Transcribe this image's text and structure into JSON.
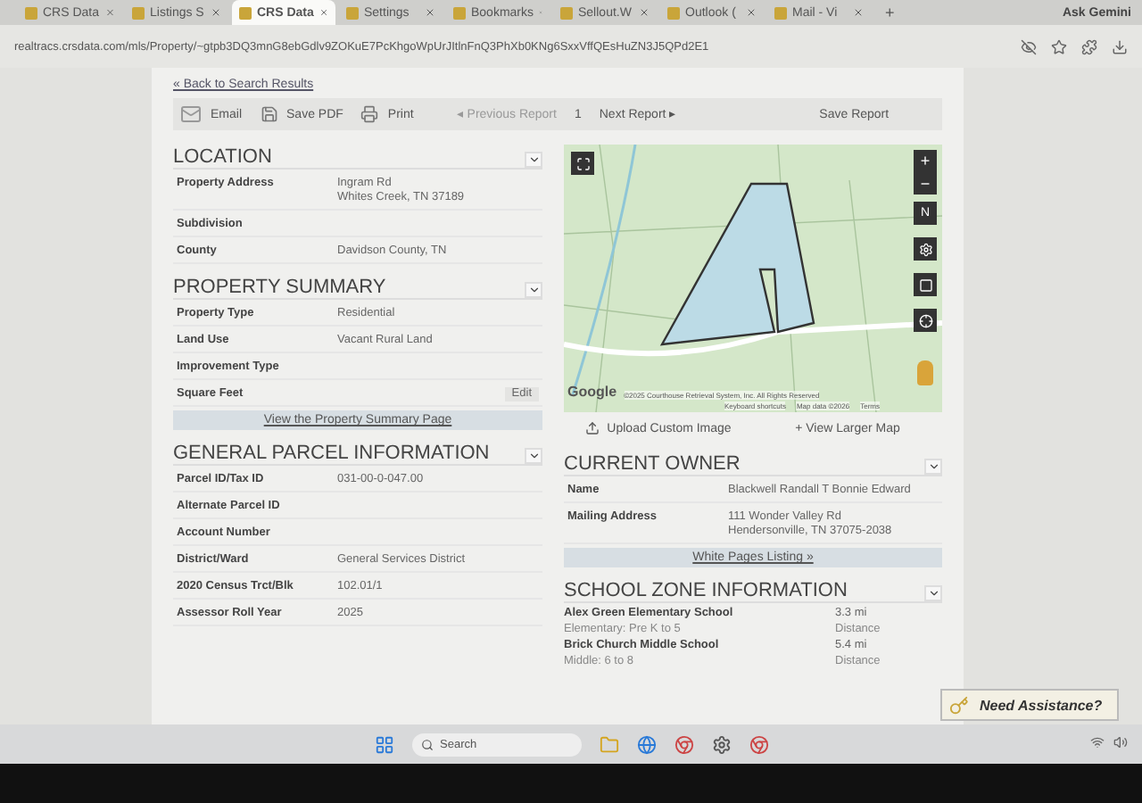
{
  "browser": {
    "tabs": [
      {
        "label": "CRS Data",
        "selected": false
      },
      {
        "label": "Listings S",
        "selected": false
      },
      {
        "label": "CRS Data",
        "selected": true
      },
      {
        "label": "Settings",
        "selected": false
      },
      {
        "label": "Bookmarks",
        "selected": false
      },
      {
        "label": "Sellout.W",
        "selected": false
      },
      {
        "label": "Outlook (",
        "selected": false
      },
      {
        "label": "Mail - Vi",
        "selected": false
      }
    ],
    "new_tab": "+",
    "gemini": "Ask Gemini",
    "url": "realtracs.crsdata.com/mls/Property/~gtpb3DQ3mnG8ebGdlv9ZOKuE7PcKhgoWpUrJItlnFnQ3PhXb0KNg6SxxVffQEsHuZN3J5QPd2E1"
  },
  "nav": {
    "back": "« Back to Search Results"
  },
  "toolbar": {
    "email": "Email",
    "save_pdf": "Save PDF",
    "print": "Print",
    "previous": "◂ Previous Report",
    "page": "1",
    "next": "Next Report ▸",
    "save": "Save Report"
  },
  "location": {
    "title": "LOCATION",
    "rows": [
      {
        "label": "Property Address",
        "value_lines": [
          "Ingram Rd",
          "Whites Creek, TN 37189"
        ]
      },
      {
        "label": "Subdivision",
        "value_lines": []
      },
      {
        "label": "County",
        "value_lines": [
          "Davidson County, TN"
        ]
      }
    ]
  },
  "summary": {
    "title": "PROPERTY SUMMARY",
    "rows": [
      {
        "label": "Property Type",
        "value_lines": [
          "Residential"
        ]
      },
      {
        "label": "Land Use",
        "value_lines": [
          "Vacant Rural Land"
        ]
      },
      {
        "label": "Improvement Type",
        "value_lines": []
      },
      {
        "label": "Square Feet",
        "value_lines": []
      }
    ],
    "edit": "Edit",
    "link": "View the Property Summary Page"
  },
  "parcel": {
    "title": "GENERAL PARCEL INFORMATION",
    "rows": [
      {
        "label": "Parcel ID/Tax ID",
        "value_lines": [
          "031-00-0-047.00"
        ]
      },
      {
        "label": "Alternate Parcel ID",
        "value_lines": []
      },
      {
        "label": "Account Number",
        "value_lines": []
      },
      {
        "label": "District/Ward",
        "value_lines": [
          "General Services District"
        ]
      },
      {
        "label": "2020 Census Trct/Blk",
        "value_lines": [
          "102.01/1"
        ]
      },
      {
        "label": "Assessor Roll Year",
        "value_lines": [
          "2025"
        ]
      }
    ]
  },
  "map": {
    "zoom_in": "+",
    "zoom_out": "−",
    "compass": "N",
    "google": "Google",
    "copyright": "©2025 Courthouse Retrieval System, Inc. All Rights Reserved",
    "shortcuts": "Keyboard shortcuts",
    "map_data": "Map data ©2026",
    "terms": "Terms",
    "upload": "Upload Custom Image",
    "larger": "+ View Larger Map"
  },
  "owner": {
    "title": "CURRENT OWNER",
    "rows": [
      {
        "label": "Name",
        "value_lines": [
          "Blackwell Randall T Bonnie Edward"
        ]
      },
      {
        "label": "Mailing Address",
        "value_lines": [
          "111 Wonder Valley Rd",
          "Hendersonville, TN 37075-2038"
        ]
      }
    ],
    "link": "White Pages Listing »"
  },
  "schools": {
    "title": "SCHOOL ZONE INFORMATION",
    "rows": [
      {
        "name": "Alex Green Elementary School",
        "grades": "Elementary: Pre K to 5",
        "distance": "3.3 mi",
        "distance_label": "Distance"
      },
      {
        "name": "Brick Church Middle School",
        "grades": "Middle: 6 to 8",
        "distance": "5.4 mi",
        "distance_label": "Distance"
      }
    ]
  },
  "assist": "Need Assistance?",
  "taskbar": {
    "search": "Search"
  }
}
